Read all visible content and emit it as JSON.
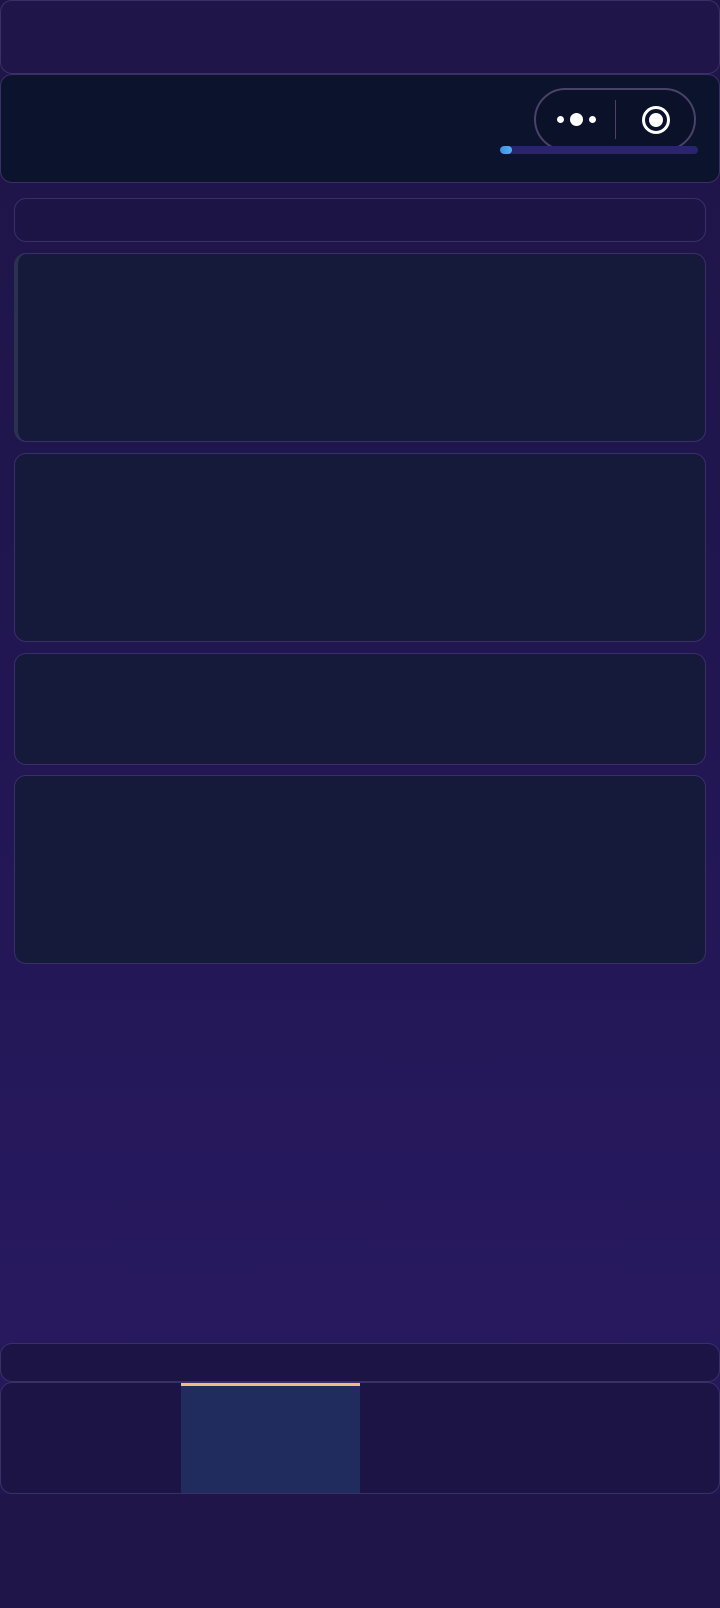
{
  "top_bar": {},
  "header": {
    "capsule": {
      "menu_icon": "more-dots-icon",
      "close_icon": "target-close-icon"
    },
    "progress": {
      "value": 0.06,
      "track_color": "#2a2470",
      "fill_color": "#56b0f5"
    }
  },
  "cards": [
    {
      "id": 1
    },
    {
      "id": 2
    },
    {
      "id": 3
    },
    {
      "id": 4
    }
  ],
  "tab_bar": {
    "active_index": 1,
    "active_indicator_color": "#f0c07a",
    "tabs": [
      {
        "label": ""
      },
      {
        "label": ""
      },
      {
        "label": ""
      },
      {
        "label": ""
      }
    ]
  },
  "colors": {
    "background": "#211652",
    "card": "#151a3a",
    "accent": "#f0c07a"
  }
}
